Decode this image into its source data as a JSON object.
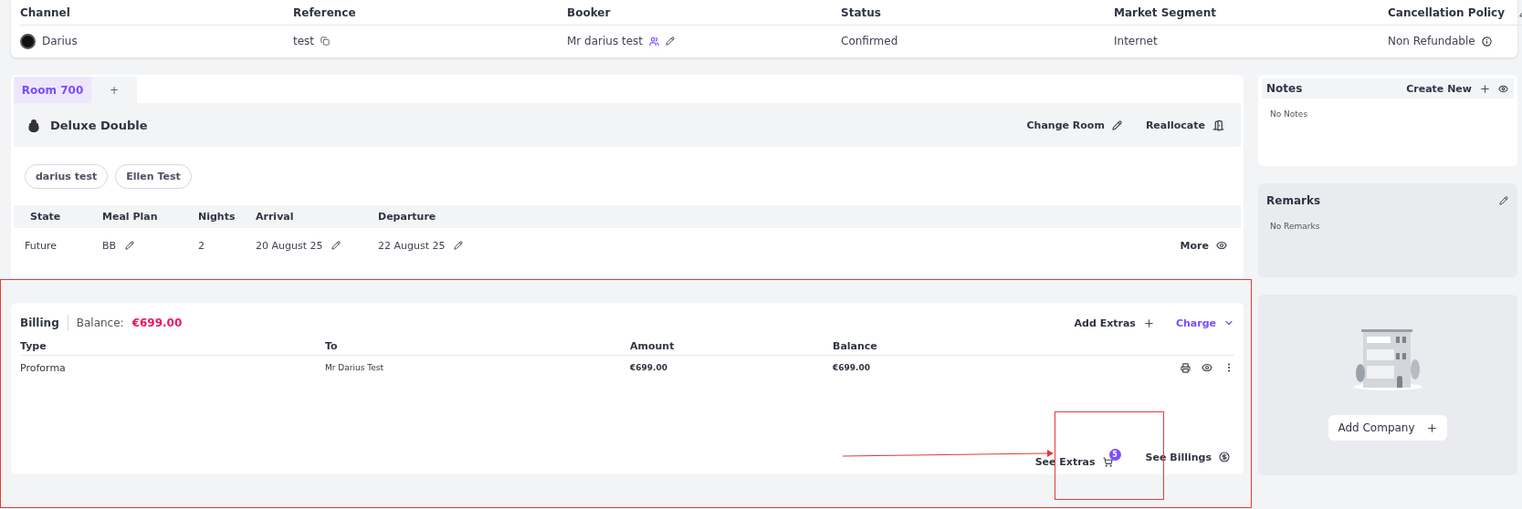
{
  "booking": {
    "columns": [
      {
        "label": "Channel",
        "value": "Darius",
        "kind": "avatar"
      },
      {
        "label": "Reference",
        "value": "test",
        "kind": "copy"
      },
      {
        "label": "Booker",
        "value": "Mr darius test",
        "kind": "booker"
      },
      {
        "label": "Status",
        "value": "Confirmed",
        "kind": "plain"
      },
      {
        "label": "Market Segment",
        "value": "Internet",
        "kind": "plain"
      },
      {
        "label": "Cancellation Policy",
        "value": "Non Refundable",
        "kind": "info"
      }
    ]
  },
  "room": {
    "tabs": [
      {
        "label": "Room 700",
        "selected": true
      },
      {
        "label": "+",
        "selected": false
      }
    ],
    "room_type": "Deluxe Double",
    "actions": [
      {
        "label": "Change Room",
        "kind": "edit"
      },
      {
        "label": "Reallocate",
        "kind": "door"
      }
    ],
    "guests": [
      "darius test",
      "Ellen Test"
    ],
    "columns": [
      "State",
      "Meal Plan",
      "Nights",
      "Arrival",
      "Departure"
    ],
    "row": [
      {
        "text": "Future",
        "editable": false
      },
      {
        "text": "BB",
        "editable": true
      },
      {
        "text": "2",
        "editable": false
      },
      {
        "text": "20 August 25",
        "editable": true
      },
      {
        "text": "22 August 25",
        "editable": true
      }
    ],
    "more": "More"
  },
  "billing": {
    "title": "Billing",
    "balance_label": "Balance:",
    "balance": "€699.00",
    "add_extras": "Add Extras",
    "charge": "Charge",
    "columns": [
      "Type",
      "To",
      "Amount",
      "Balance"
    ],
    "rows": [
      [
        "Proforma",
        "Mr Darius Test",
        "€699.00",
        "€699.00"
      ]
    ],
    "see_extras": "See Extras",
    "extras_count": "5",
    "see_billings": "See Billings"
  },
  "notes": {
    "title": "Notes",
    "create": "Create New",
    "empty": "No Notes"
  },
  "remarks": {
    "title": "Remarks",
    "empty": "No Remarks"
  },
  "company": {
    "button": "Add Company"
  }
}
